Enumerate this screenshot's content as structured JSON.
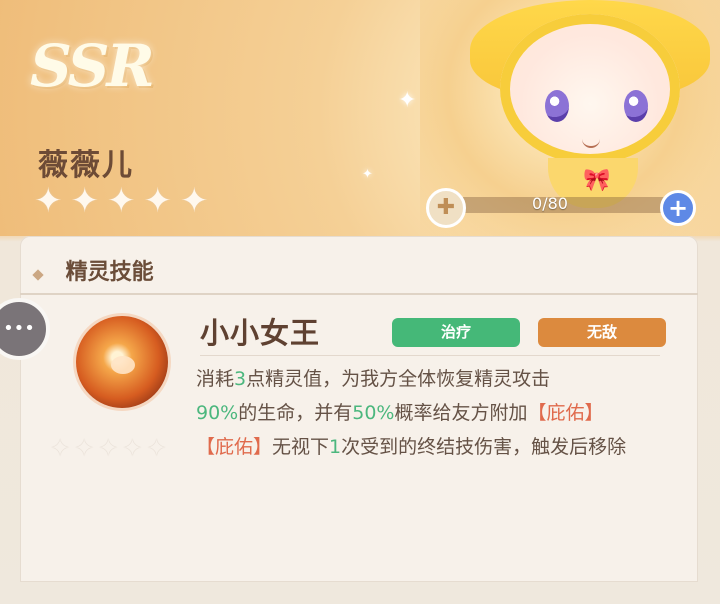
{
  "header": {
    "rarity": "SSR",
    "name": "薇薇儿",
    "progress": {
      "text": "0/80",
      "current": 0,
      "max": 80
    }
  },
  "panel": {
    "section_title": "精灵技能",
    "skill": {
      "name": "小小女王",
      "tags": [
        "治疗",
        "无敌"
      ],
      "description_segments": {
        "line1_a": "消耗",
        "line1_b": "3",
        "line1_c": "点精灵值，为我方全体恢复精灵攻击",
        "line2_a": "90%",
        "line2_b": "的生命，并有",
        "line2_c": "50%",
        "line2_d": "概率给友方附加",
        "line2_e": "【庇佑】",
        "line3_a": "【庇佑】",
        "line3_b": "无视下",
        "line3_c": "1",
        "line3_d": "次受到的终结技伤害，触发后移除"
      }
    }
  },
  "icons": {
    "sparkle": "✦",
    "star": "✦",
    "plus": "+",
    "chat": "•••",
    "shard": "✚"
  },
  "colors": {
    "heal": "#45b878",
    "invincible": "#dc8a3e",
    "green_text": "#4cb77e",
    "red_text": "#e06a4c"
  }
}
